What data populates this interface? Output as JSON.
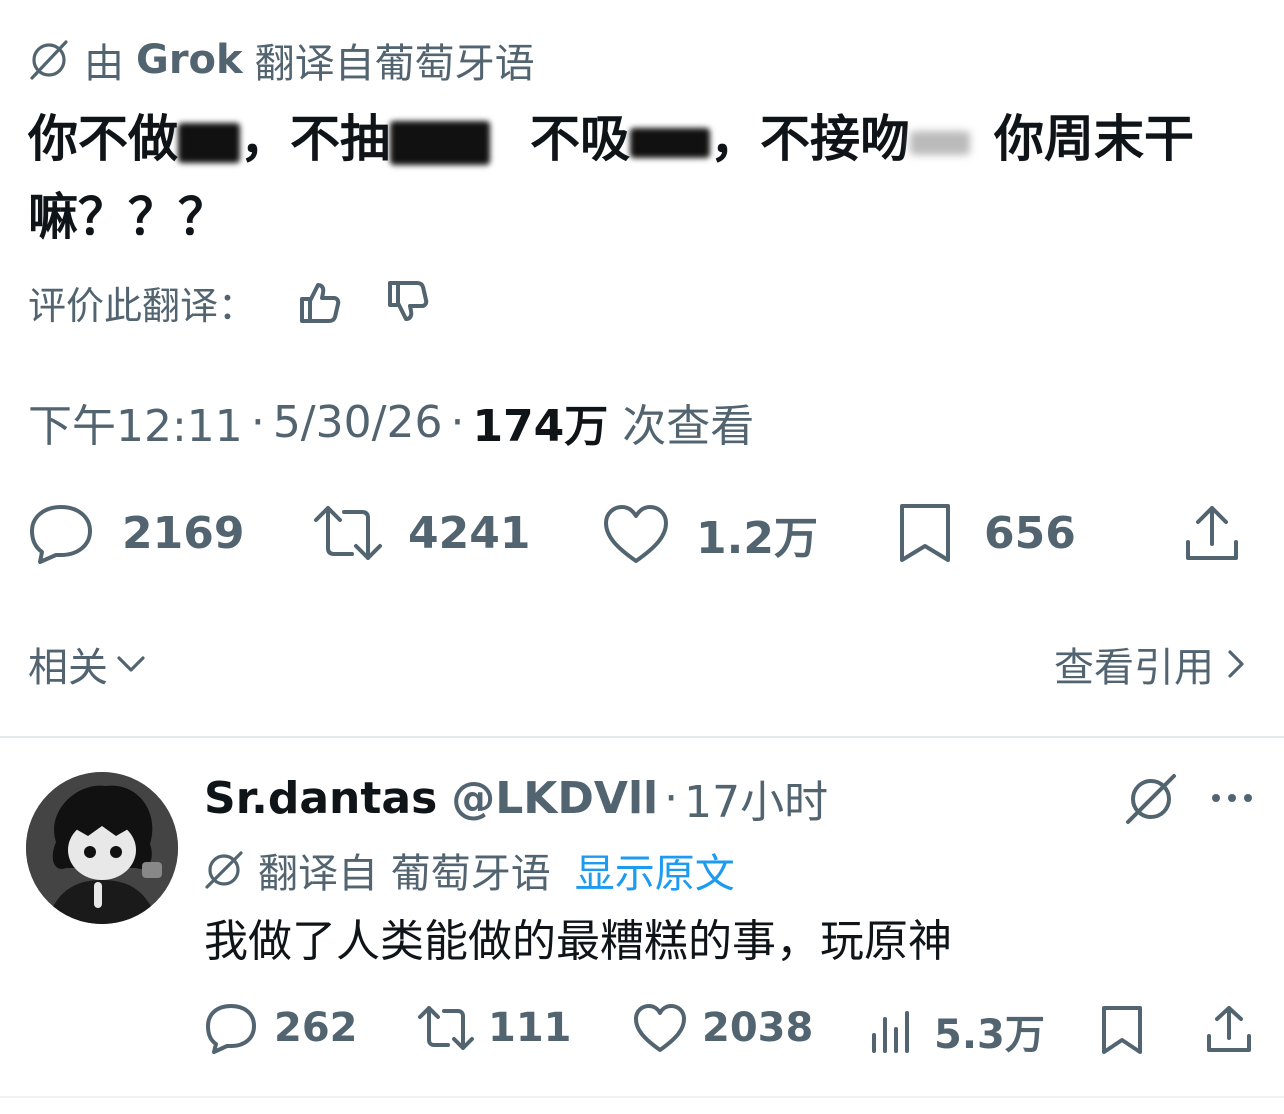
{
  "header": {
    "translated_by": "由",
    "grok": "Grok",
    "translated_from": "翻译自葡萄牙语"
  },
  "post": {
    "seg1": "你不做",
    "seg2": "，不抽",
    "seg3": "不吸",
    "seg4": "，不接吻",
    "seg5": "你周末干",
    "line2": "嘛？？？"
  },
  "rate": {
    "label": "评价此翻译："
  },
  "meta": {
    "time": "下午12:11",
    "dot": "·",
    "date": "5/30/26",
    "views_count": "174万",
    "views_label": "次查看"
  },
  "actions": {
    "replies": "2169",
    "reposts": "4241",
    "likes": "1.2万",
    "bookmarks": "656"
  },
  "related": {
    "label": "相关",
    "quotes_link": "查看引用"
  },
  "reply": {
    "name": "Sr.dantas",
    "handle": "@LKDVll",
    "dot": "·",
    "time": "17小时",
    "translated_from": "翻译自 葡萄牙语",
    "show_original": "显示原文",
    "text": "我做了人类能做的最糟糕的事，玩原神",
    "replies": "262",
    "reposts": "111",
    "likes": "2038",
    "views": "5.3万"
  },
  "colors": {
    "accent": "#1d9bf0",
    "muted": "#536471",
    "text": "#0f1419",
    "divider": "#eff3f4"
  },
  "icons": [
    "translate-icon",
    "thumbs-up-icon",
    "thumbs-down-icon",
    "reply-icon",
    "repost-icon",
    "like-icon",
    "bookmark-icon",
    "share-icon",
    "views-icon",
    "more-icon",
    "chevron-down-icon",
    "chevron-right-icon"
  ]
}
